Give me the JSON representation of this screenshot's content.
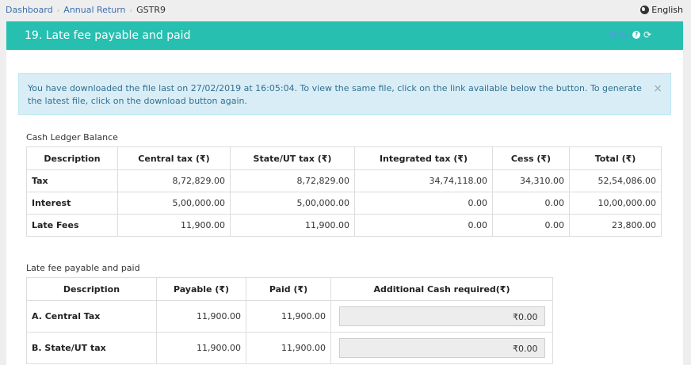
{
  "breadcrumb": {
    "items": [
      "Dashboard",
      "Annual Return"
    ],
    "current": "GSTR9"
  },
  "language": "English",
  "header": {
    "title": "19. Late fee payable and paid",
    "help": "Help"
  },
  "alert": {
    "message": "You have downloaded the file last on 27/02/2019 at 16:05:04. To view the same file, click on the link available below the button. To generate the latest file, click on the download button again.",
    "close": "×"
  },
  "cash_ledger": {
    "label": "Cash Ledger Balance",
    "headers": [
      "Description",
      "Central tax (₹)",
      "State/UT tax (₹)",
      "Integrated tax (₹)",
      "Cess (₹)",
      "Total (₹)"
    ],
    "rows": [
      [
        "Tax",
        "8,72,829.00",
        "8,72,829.00",
        "34,74,118.00",
        "34,310.00",
        "52,54,086.00"
      ],
      [
        "Interest",
        "5,00,000.00",
        "5,00,000.00",
        "0.00",
        "0.00",
        "10,00,000.00"
      ],
      [
        "Late Fees",
        "11,900.00",
        "11,900.00",
        "0.00",
        "0.00",
        "23,800.00"
      ]
    ]
  },
  "late_fee": {
    "label": "Late fee payable and paid",
    "headers": [
      "Description",
      "Payable (₹)",
      "Paid (₹)",
      "Additional Cash required(₹)"
    ],
    "rows": [
      [
        "A. Central Tax",
        "11,900.00",
        "11,900.00",
        "₹0.00"
      ],
      [
        "B. State/UT tax",
        "11,900.00",
        "11,900.00",
        "₹0.00"
      ]
    ]
  }
}
